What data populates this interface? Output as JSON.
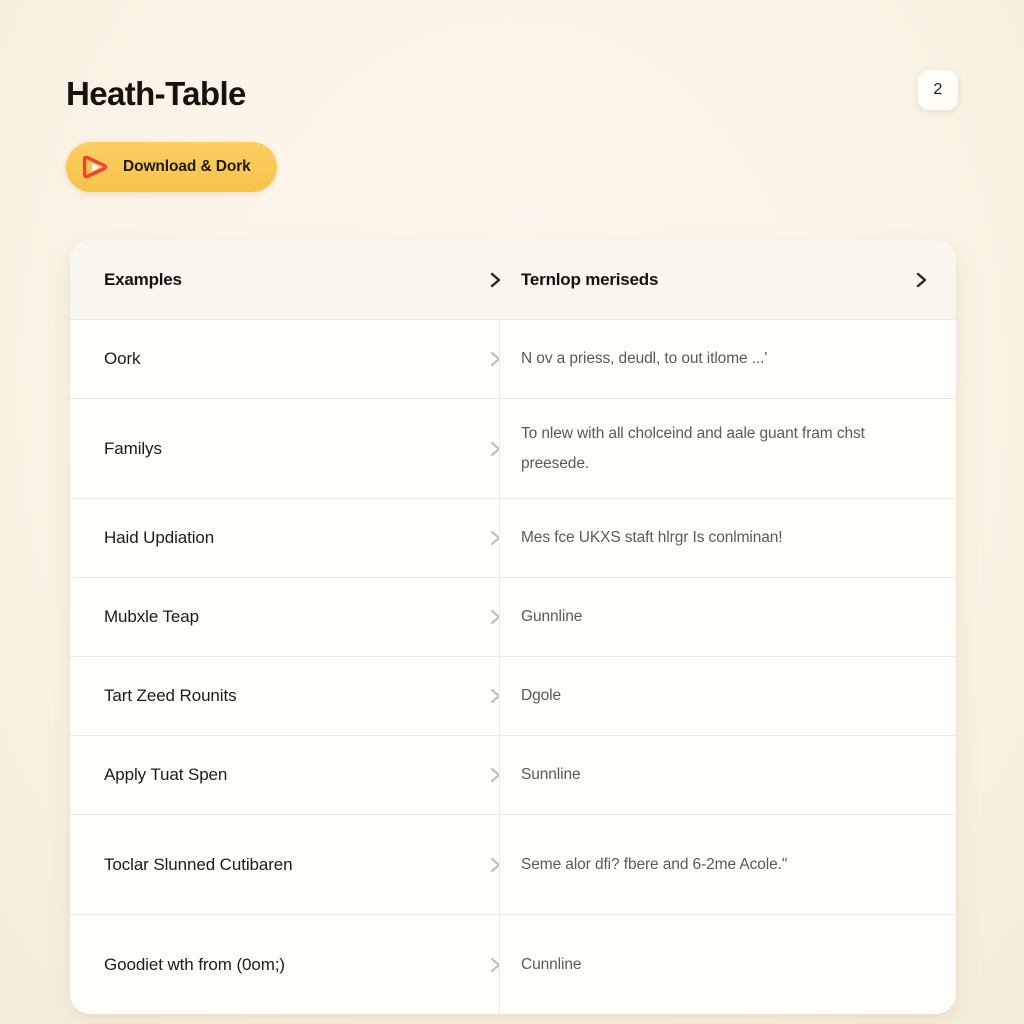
{
  "header": {
    "title": "Heath-Table",
    "badge_count": "2"
  },
  "cta": {
    "label": "Download & Dork",
    "icon": "play-icon",
    "bg_color": "#F8C44E",
    "icon_color": "#EF4136"
  },
  "table": {
    "columns": [
      {
        "label": "Examples",
        "chevron": "chevron-right-icon"
      },
      {
        "label": "Ternlop meriseds",
        "chevron": "chevron-right-icon"
      }
    ],
    "rows": [
      {
        "name": "Oork",
        "desc": "N ov a priess, deudl, to out itlome ...'",
        "tall": false
      },
      {
        "name": "Familys",
        "desc": "To nlew with all cholceind and aale guant fram chst preesede.",
        "tall": true
      },
      {
        "name": "Haid Updiation",
        "desc": "Mes fce UKXS staft hlrgr Is conlminan!",
        "tall": false
      },
      {
        "name": "Mubxle Teap",
        "desc": "Gunnline",
        "tall": false
      },
      {
        "name": "Tart Zeed Rounits",
        "desc": "Dgole",
        "tall": false
      },
      {
        "name": "Apply Tuat Spen",
        "desc": "Sunnline",
        "tall": false
      },
      {
        "name": "Toclar Slunned Cutibaren",
        "desc": "Seme alor dfi? fbere and 6-2me  Acole.\"",
        "tall": true
      },
      {
        "name": "Goodiet wth from (0om;)",
        "desc": "Cunnline",
        "tall": false
      }
    ]
  },
  "colors": {
    "page_bg": "#FBF4E7",
    "card_bg": "#FFFEFB",
    "header_row_bg": "#F9F6F0",
    "text_primary": "#1F1C17",
    "text_secondary": "#5D5A55",
    "divider": "#EDEAE4"
  }
}
